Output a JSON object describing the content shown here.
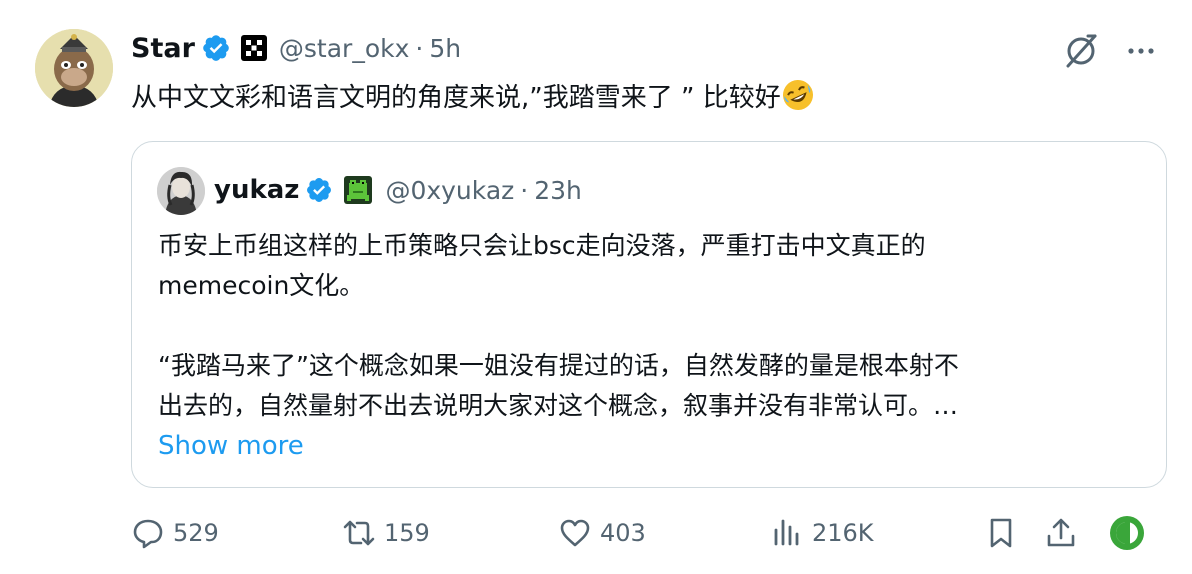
{
  "tweet": {
    "author_name": "Star",
    "author_handle": "@star_okx",
    "separator": "·",
    "time": "5h",
    "text": "从中文文彩和语言文明的角度来说,”我踏雪来了 ” 比较好",
    "text_emoji": "rolling-on-floor-laughing-emoji"
  },
  "quote": {
    "author_name": "yukaz",
    "author_handle": "@0xyukaz",
    "separator": "·",
    "time": "23h",
    "lines": [
      "币安上币组这样的上币策略只会让bsc走向没落，严重打击中文真正的",
      "memecoin文化。",
      "“我踏马来了”这个概念如果一姐没有提过的话，自然发酵的量是根本射不",
      "出去的，自然量射不出去说明大家对这个概念，叙事并没有非常认可。…"
    ],
    "show_more": "Show more"
  },
  "actions": {
    "replies": "529",
    "reposts": "159",
    "likes": "403",
    "views": "216K"
  },
  "colors": {
    "text": "#0f1419",
    "muted": "#536471",
    "link": "#1d9bf0",
    "verified": "#1d9bf0",
    "border": "#cfd9de"
  }
}
